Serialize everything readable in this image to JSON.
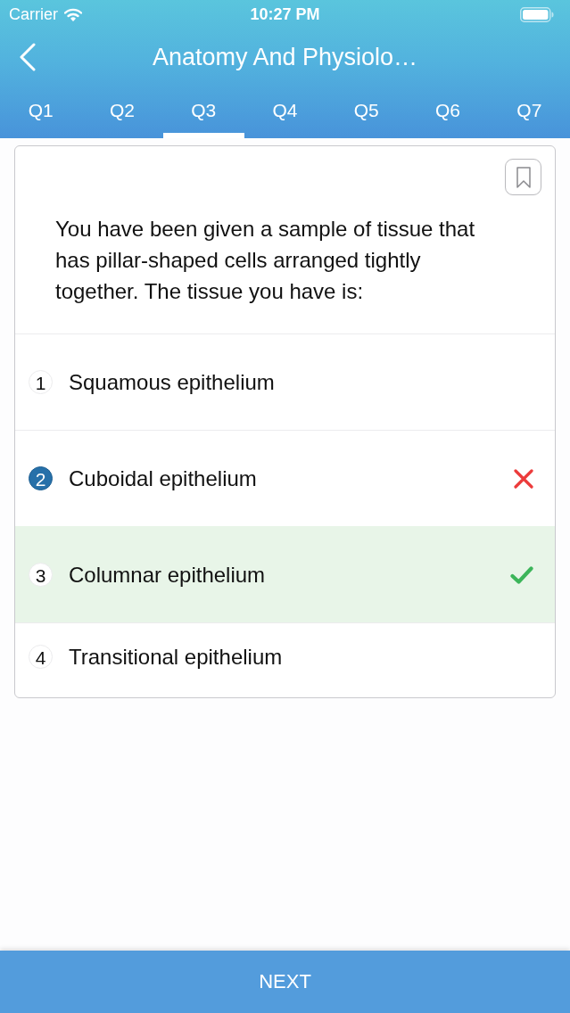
{
  "status_bar": {
    "carrier": "Carrier",
    "time": "10:27 PM"
  },
  "nav": {
    "title": "Anatomy And Physiolo…"
  },
  "tabs": [
    {
      "label": "Q1",
      "selected": false
    },
    {
      "label": "Q2",
      "selected": false
    },
    {
      "label": "Q3",
      "selected": true
    },
    {
      "label": "Q4",
      "selected": false
    },
    {
      "label": "Q5",
      "selected": false
    },
    {
      "label": "Q6",
      "selected": false
    },
    {
      "label": "Q7",
      "selected": false
    }
  ],
  "question": {
    "bookmarked": false,
    "text": "You have been given a sample of tissue that has pillar-shaped cells arranged tightly together. The tissue you have is:"
  },
  "options": [
    {
      "number": "1",
      "text": "Squamous epithelium",
      "selected": false,
      "wrong": false,
      "correct": false
    },
    {
      "number": "2",
      "text": "Cuboidal epithelium",
      "selected": true,
      "wrong": true,
      "correct": false
    },
    {
      "number": "3",
      "text": "Columnar epithelium",
      "selected": false,
      "wrong": false,
      "correct": true
    },
    {
      "number": "4",
      "text": "Transitional epithelium",
      "selected": false,
      "wrong": false,
      "correct": false
    }
  ],
  "next_button": {
    "label": "NEXT"
  }
}
